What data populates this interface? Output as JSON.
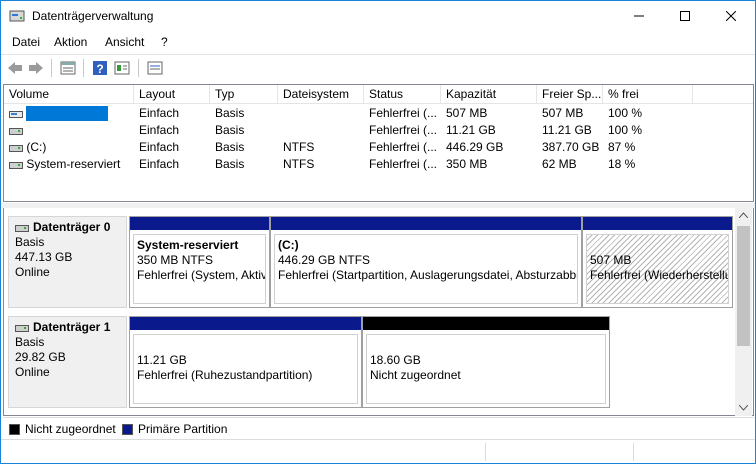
{
  "window": {
    "title": "Datenträgerverwaltung"
  },
  "menu": [
    {
      "label": "Datei"
    },
    {
      "label": "Aktion"
    },
    {
      "label": "Ansicht"
    },
    {
      "label": "?"
    }
  ],
  "table": {
    "columns": [
      "Volume",
      "Layout",
      "Typ",
      "Dateisystem",
      "Status",
      "Kapazität",
      "Freier Sp...",
      "% frei"
    ],
    "rows": [
      {
        "volume": "",
        "layout": "Einfach",
        "typ": "Basis",
        "fs": "",
        "status": "Fehlerfrei (...",
        "kap": "507 MB",
        "frei": "507 MB",
        "pct": "100 %",
        "selected": true
      },
      {
        "volume": "",
        "layout": "Einfach",
        "typ": "Basis",
        "fs": "",
        "status": "Fehlerfrei (...",
        "kap": "11.21 GB",
        "frei": "11.21 GB",
        "pct": "100 %"
      },
      {
        "volume": "(C:)",
        "layout": "Einfach",
        "typ": "Basis",
        "fs": "NTFS",
        "status": "Fehlerfrei (...",
        "kap": "446.29 GB",
        "frei": "387.70 GB",
        "pct": "87 %"
      },
      {
        "volume": "System-reserviert",
        "layout": "Einfach",
        "typ": "Basis",
        "fs": "NTFS",
        "status": "Fehlerfrei (...",
        "kap": "350 MB",
        "frei": "62 MB",
        "pct": "18 %"
      }
    ]
  },
  "disks": [
    {
      "name": "Datenträger 0",
      "type": "Basis",
      "size": "447.13 GB",
      "state": "Online",
      "partitions": [
        {
          "title": "System-reserviert",
          "size": "350 MB NTFS",
          "status": "Fehlerfrei (System, Aktiv",
          "bar": "primary"
        },
        {
          "title": "(C:)",
          "size": "446.29 GB NTFS",
          "status": "Fehlerfrei (Startpartition, Auslagerungsdatei, Absturzabbi",
          "bar": "primary"
        },
        {
          "title": "",
          "size": "507 MB",
          "status": "Fehlerfrei (Wiederherstellu",
          "bar": "primary",
          "selected": true
        }
      ]
    },
    {
      "name": "Datenträger 1",
      "type": "Basis",
      "size": "29.82 GB",
      "state": "Online",
      "partitions": [
        {
          "title": "",
          "size": "11.21 GB",
          "status": "Fehlerfrei (Ruhezustandpartition)",
          "bar": "primary"
        },
        {
          "title": "",
          "size": "18.60 GB",
          "status": "Nicht zugeordnet",
          "bar": "unallocated"
        }
      ]
    }
  ],
  "legend": [
    {
      "label": "Nicht zugeordnet",
      "color": "#000000"
    },
    {
      "label": "Primäre Partition",
      "color": "#0a1a8c"
    }
  ],
  "colors": {
    "primary": "#0a1a8c",
    "unallocated": "#000000",
    "selection": "#0078d7"
  }
}
